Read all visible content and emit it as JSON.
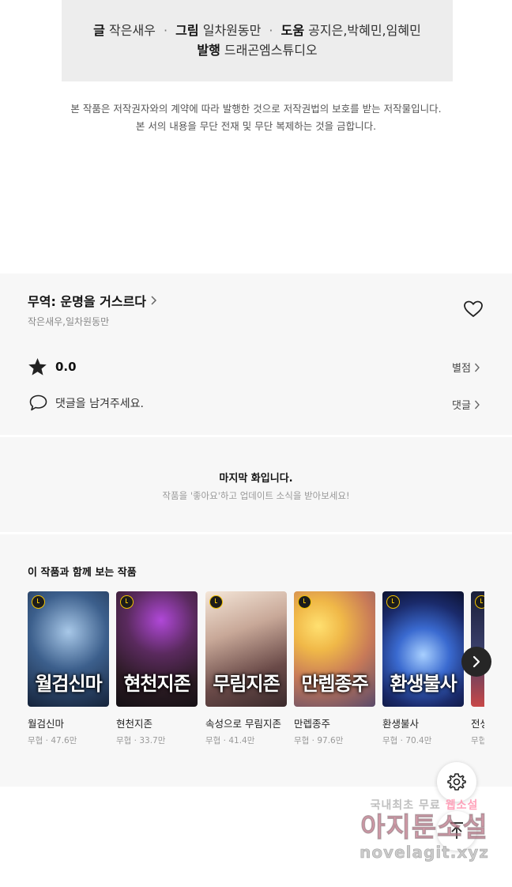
{
  "credits": {
    "story_label": "글",
    "story_author": "작은새우",
    "art_label": "그림",
    "art_author": "일차원동만",
    "assist_label": "도움",
    "assistants": "공지은,박혜민,임혜민",
    "publisher_label": "발행",
    "publisher": "드래곤엠스튜디오",
    "separator": "·"
  },
  "copyright": {
    "line1": "본 작품은 저작권자와의 계약에 따라 발행한 것으로 저작권법의 보호를 받는 저작물입니다.",
    "line2": "본 서의 내용을 무단 전재 및 무단 복제하는 것을 금합니다."
  },
  "work": {
    "title": "무역: 운명을 거스르다",
    "authors": "작은새우,일차원동만",
    "rating": "0.0",
    "rating_link": "별점",
    "comment_prompt": "댓글을 남겨주세요.",
    "comment_link": "댓글"
  },
  "last_episode": {
    "heading": "마지막 화입니다.",
    "subtext": "작품을 '좋아요'하고 업데이트 소식을 받아보세요!"
  },
  "recommendations": {
    "heading": "이 작품과 함께 보는 작품",
    "items": [
      {
        "title": "월검신마",
        "genre": "무협",
        "views": "47.6만",
        "cover_text": "월검신마"
      },
      {
        "title": "현천지존",
        "genre": "무협",
        "views": "33.7만",
        "cover_text": "현천지존"
      },
      {
        "title": "속성으로 무림지존",
        "genre": "무협",
        "views": "41.4만",
        "cover_text": "무림지존"
      },
      {
        "title": "만렙종주",
        "genre": "무협",
        "views": "97.6만",
        "cover_text": "만렙종주"
      },
      {
        "title": "환생불사",
        "genre": "무협",
        "views": "70.4만",
        "cover_text": "환생불사"
      },
      {
        "title": "전생",
        "genre": "무협",
        "views": "",
        "cover_text": ""
      }
    ]
  },
  "watermark": {
    "line1_a": "국내최초 무료",
    "line1_b": "웹소설",
    "line2": "아지툰소설",
    "line3": "novelagit.xyz"
  },
  "colors": {
    "section_bg": "#f7f7f7",
    "credits_bg": "#ededed",
    "badge": "#f0c000"
  }
}
